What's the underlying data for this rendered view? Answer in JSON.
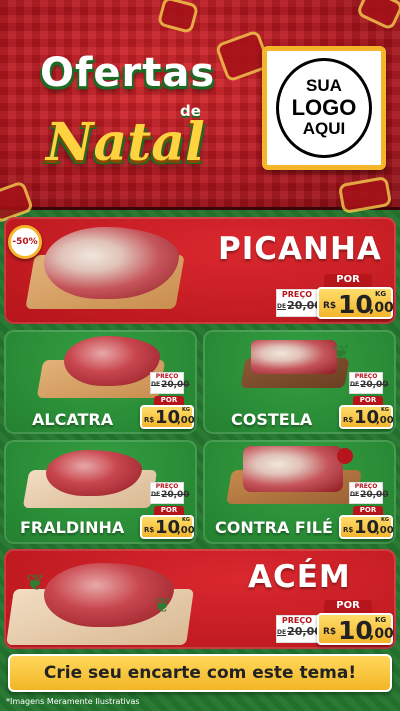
{
  "header": {
    "title_line1": "Ofertas",
    "title_de": "de",
    "title_line2": "Natal",
    "logo_line1": "SUA",
    "logo_line2": "LOGO",
    "logo_line3": "AQUI"
  },
  "products": [
    {
      "name": "PICANHA",
      "discount": "-50%",
      "preco_label": "PREÇO",
      "de": "DE",
      "old_price": "20,00",
      "por_label": "POR",
      "currency": "R$",
      "price_int": "10",
      "price_dec": ",00",
      "unit": "KG"
    },
    {
      "name": "ALCATRA",
      "preco_label": "PREÇO",
      "de": "DE",
      "old_price": "20,00",
      "por_label": "POR",
      "currency": "R$",
      "price_int": "10",
      "price_dec": ",00",
      "unit": "KG"
    },
    {
      "name": "COSTELA",
      "preco_label": "PREÇO",
      "de": "DE",
      "old_price": "20,00",
      "por_label": "POR",
      "currency": "R$",
      "price_int": "10",
      "price_dec": ",00",
      "unit": "KG"
    },
    {
      "name": "FRALDINHA",
      "preco_label": "PREÇO",
      "de": "DE",
      "old_price": "20,00",
      "por_label": "POR",
      "currency": "R$",
      "price_int": "10",
      "price_dec": ",00",
      "unit": "KG"
    },
    {
      "name": "CONTRA FILÉ",
      "preco_label": "PREÇO",
      "de": "DE",
      "old_price": "20,00",
      "por_label": "POR",
      "currency": "R$",
      "price_int": "10",
      "price_dec": ",00",
      "unit": "KG"
    },
    {
      "name": "ACÉM",
      "preco_label": "PREÇO",
      "de": "DE",
      "old_price": "20,00",
      "por_label": "POR",
      "currency": "R$",
      "price_int": "10",
      "price_dec": ",00",
      "unit": "KG"
    }
  ],
  "footer": {
    "cta": "Crie seu encarte com este tema!",
    "disclaimer": "*Imagens Meramente Ilustrativas"
  },
  "colors": {
    "red": "#b5151b",
    "green": "#2b8f39",
    "gold": "#f4b52b"
  }
}
